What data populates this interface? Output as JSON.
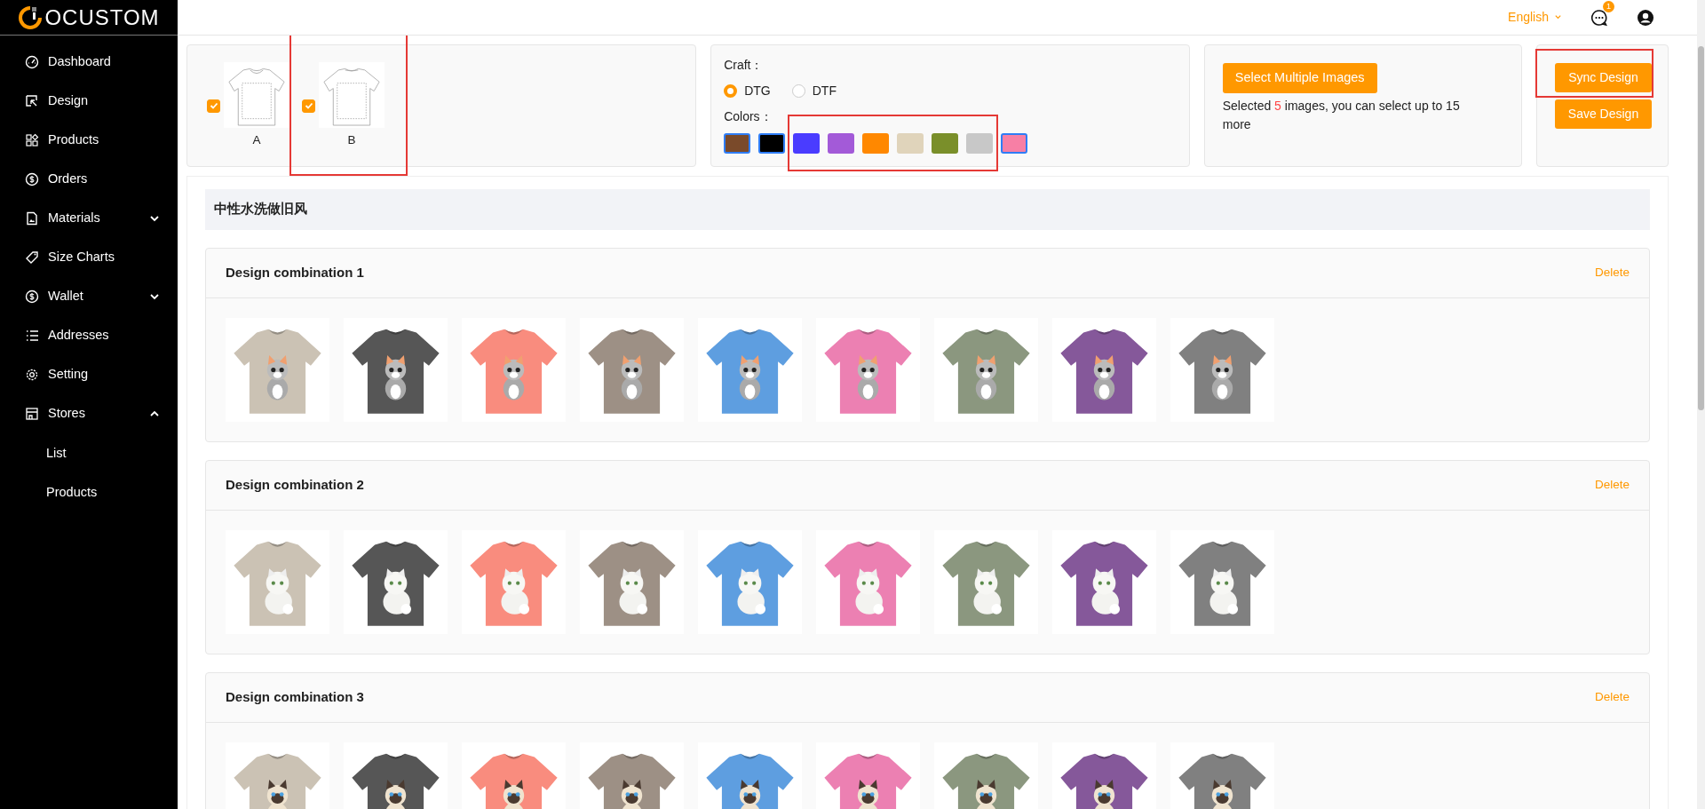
{
  "brand": {
    "name": "OCUSTOM"
  },
  "sidebar": {
    "items": [
      {
        "label": "Dashboard"
      },
      {
        "label": "Design"
      },
      {
        "label": "Products"
      },
      {
        "label": "Orders"
      },
      {
        "label": "Materials",
        "expanded": false
      },
      {
        "label": "Size Charts"
      },
      {
        "label": "Wallet",
        "expanded": false
      },
      {
        "label": "Addresses"
      },
      {
        "label": "Setting"
      },
      {
        "label": "Stores",
        "expanded": true,
        "children": [
          {
            "label": "List"
          },
          {
            "label": "Products"
          }
        ]
      }
    ]
  },
  "topbar": {
    "language": "English",
    "notification_count": "1"
  },
  "mockups": [
    {
      "label": "A",
      "checked": true,
      "highlighted": false,
      "kind": "front"
    },
    {
      "label": "B",
      "checked": true,
      "highlighted": true,
      "kind": "back"
    }
  ],
  "craft": {
    "label": "Craft：",
    "options": [
      {
        "label": "DTG",
        "selected": true
      },
      {
        "label": "DTF",
        "selected": false
      }
    ]
  },
  "colors": {
    "label": "Colors：",
    "groups": [
      {
        "highlighted": false,
        "items": [
          {
            "color": "#7a4a2a",
            "selected": true
          },
          {
            "color": "#000000",
            "selected": true
          }
        ]
      },
      {
        "highlighted": true,
        "items": [
          {
            "color": "#4a3cff",
            "selected": false
          },
          {
            "color": "#a35ad8",
            "selected": false
          },
          {
            "color": "#ff8800",
            "selected": false
          },
          {
            "color": "#e0d4bb",
            "selected": false
          },
          {
            "color": "#7a8f2a",
            "selected": false
          },
          {
            "color": "#c8c8c8",
            "selected": false
          }
        ]
      },
      {
        "highlighted": false,
        "items": [
          {
            "color": "#f77fa5",
            "selected": true
          }
        ]
      }
    ]
  },
  "images": {
    "button": "Select Multiple Images",
    "note": "Selected **5** images, you can select up to 15 more"
  },
  "actions": [
    {
      "label": "Sync Design",
      "highlighted": true
    },
    {
      "label": "Save Design",
      "highlighted": false
    }
  ],
  "section": {
    "title": "中性水洗做旧风"
  },
  "combinations": [
    {
      "title": "Design combination 1",
      "delete": "Delete",
      "kind": "tabby",
      "shirts": [
        {
          "color": "#cbc2b4"
        },
        {
          "color": "#565656"
        },
        {
          "color": "#f98c7e"
        },
        {
          "color": "#9d9085"
        },
        {
          "color": "#5e9ee0"
        },
        {
          "color": "#ec80b2"
        },
        {
          "color": "#8b977f"
        },
        {
          "color": "#85589a"
        },
        {
          "color": "#808080"
        }
      ]
    },
    {
      "title": "Design combination 2",
      "delete": "Delete",
      "kind": "persian",
      "shirts": [
        {
          "color": "#cbc2b4"
        },
        {
          "color": "#565656"
        },
        {
          "color": "#f98c7e"
        },
        {
          "color": "#9d9085"
        },
        {
          "color": "#5e9ee0"
        },
        {
          "color": "#ec80b2"
        },
        {
          "color": "#8b977f"
        },
        {
          "color": "#85589a"
        },
        {
          "color": "#808080"
        }
      ]
    },
    {
      "title": "Design combination 3",
      "delete": "Delete",
      "kind": "siamese",
      "shirts": [
        {
          "color": "#cbc2b4"
        },
        {
          "color": "#565656"
        },
        {
          "color": "#f98c7e"
        },
        {
          "color": "#9d9085"
        },
        {
          "color": "#5e9ee0"
        },
        {
          "color": "#ec80b2"
        },
        {
          "color": "#8b977f"
        },
        {
          "color": "#85589a"
        },
        {
          "color": "#808080"
        }
      ]
    }
  ]
}
